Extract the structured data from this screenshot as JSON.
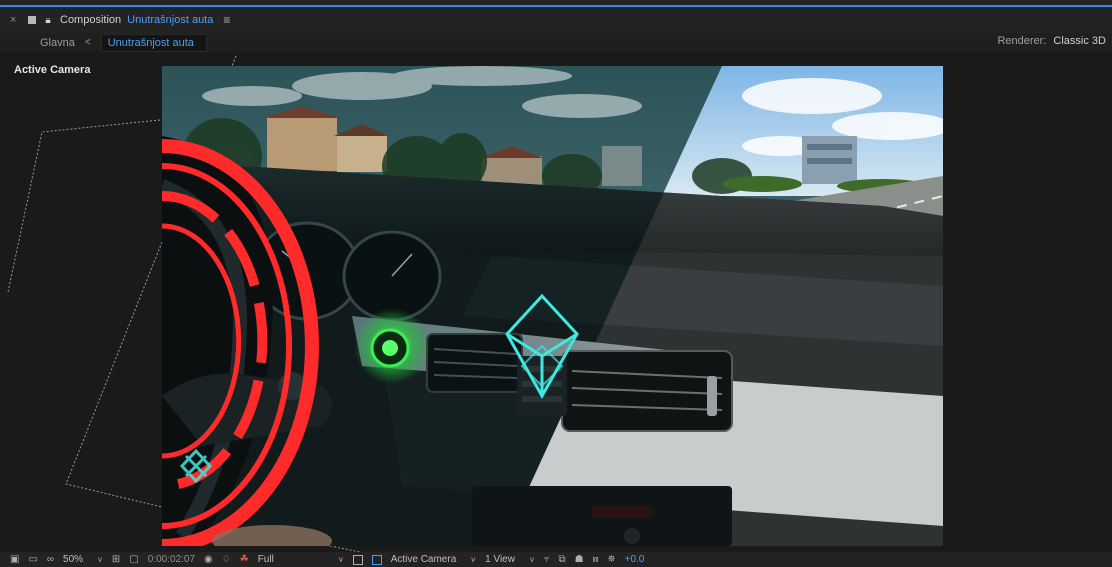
{
  "header": {
    "close_glyph": "×",
    "panel_label": "Composition",
    "comp_name": "Unutrašnjost auta",
    "menu_glyph": "≡"
  },
  "nav": {
    "root_crumb": "Glavna",
    "chevron": "<",
    "active_crumb": "Unutrašnjost auta",
    "renderer_label": "Renderer:",
    "renderer_value": "Classic 3D"
  },
  "viewer": {
    "label": "Active Camera"
  },
  "footer": {
    "zoom": "50%",
    "timecode": "0:00:02:07",
    "resolution": "Full",
    "camera": "Active Camera",
    "views": "1 View",
    "exposure": "+0.0"
  },
  "colors": {
    "accent": "#4d9ff5",
    "panel": "#232323",
    "viewer_bg": "#1a1a1a",
    "hud_red": "#ff2a2a",
    "hud_green": "#33e64d",
    "hud_cyan": "#3fe8e0"
  },
  "icons": {
    "close": "close-icon",
    "lock": "lock-icon",
    "menu": "menu-icon",
    "snapshot": "camera-icon",
    "color": "color-channels-icon"
  }
}
